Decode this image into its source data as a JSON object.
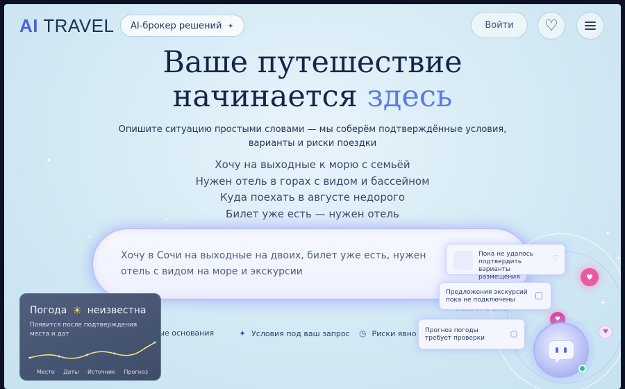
{
  "header": {
    "logo_ai": "AI",
    "logo_travel": "TRAVEL",
    "broker_label": "AI-брокер решений",
    "broker_star_icon": "sparkle-icon",
    "login_label": "Войти",
    "favorites_icon": "heart-icon",
    "menu_icon": "hamburger-menu-icon"
  },
  "hero": {
    "title_line1": "Ваше путешествие",
    "title_line2_main": "начинается",
    "title_line2_accent": "здесь",
    "subtitle": "Опишите ситуацию простыми словами — мы соберём подтверждённые условия, варианты и риски поездки",
    "examples": [
      "Хочу на выходные к морю с семьёй",
      "Нужен отель в горах с видом и бассейном",
      "Куда поехать в августе недорого",
      "Билет уже есть — нужен отель"
    ]
  },
  "search": {
    "value": "Хочу в Сочи на выходные на двоих, билет уже есть, нужен отель с видом на море и экскурсии",
    "hint": "Нажмите Enter ›"
  },
  "features": [
    {
      "label": "мые основания",
      "icon": "check-icon"
    },
    {
      "label": "Условия под ваш запрос",
      "icon": "sparkle-icon"
    },
    {
      "label": "Риски явно",
      "icon": "clock-icon"
    }
  ],
  "weather": {
    "title_prefix": "Погода",
    "title_suffix": "неизвестна",
    "icon": "sun-icon",
    "subtitle": "Появится после подтверждения места и дат",
    "labels": [
      "Место",
      "Даты",
      "Источник",
      "Прогноз"
    ]
  },
  "cards": {
    "card1": "Пока не удалось подтвердить варианты размещения",
    "card2": "Предложения экскурсий пока не подключены",
    "card3": "Прогноз погоды требует проверки"
  },
  "colors": {
    "accent": "#5a7be6",
    "brand": "#4a63d8",
    "heart_pink": "#ea5aa2",
    "status_online": "#27c08a"
  }
}
